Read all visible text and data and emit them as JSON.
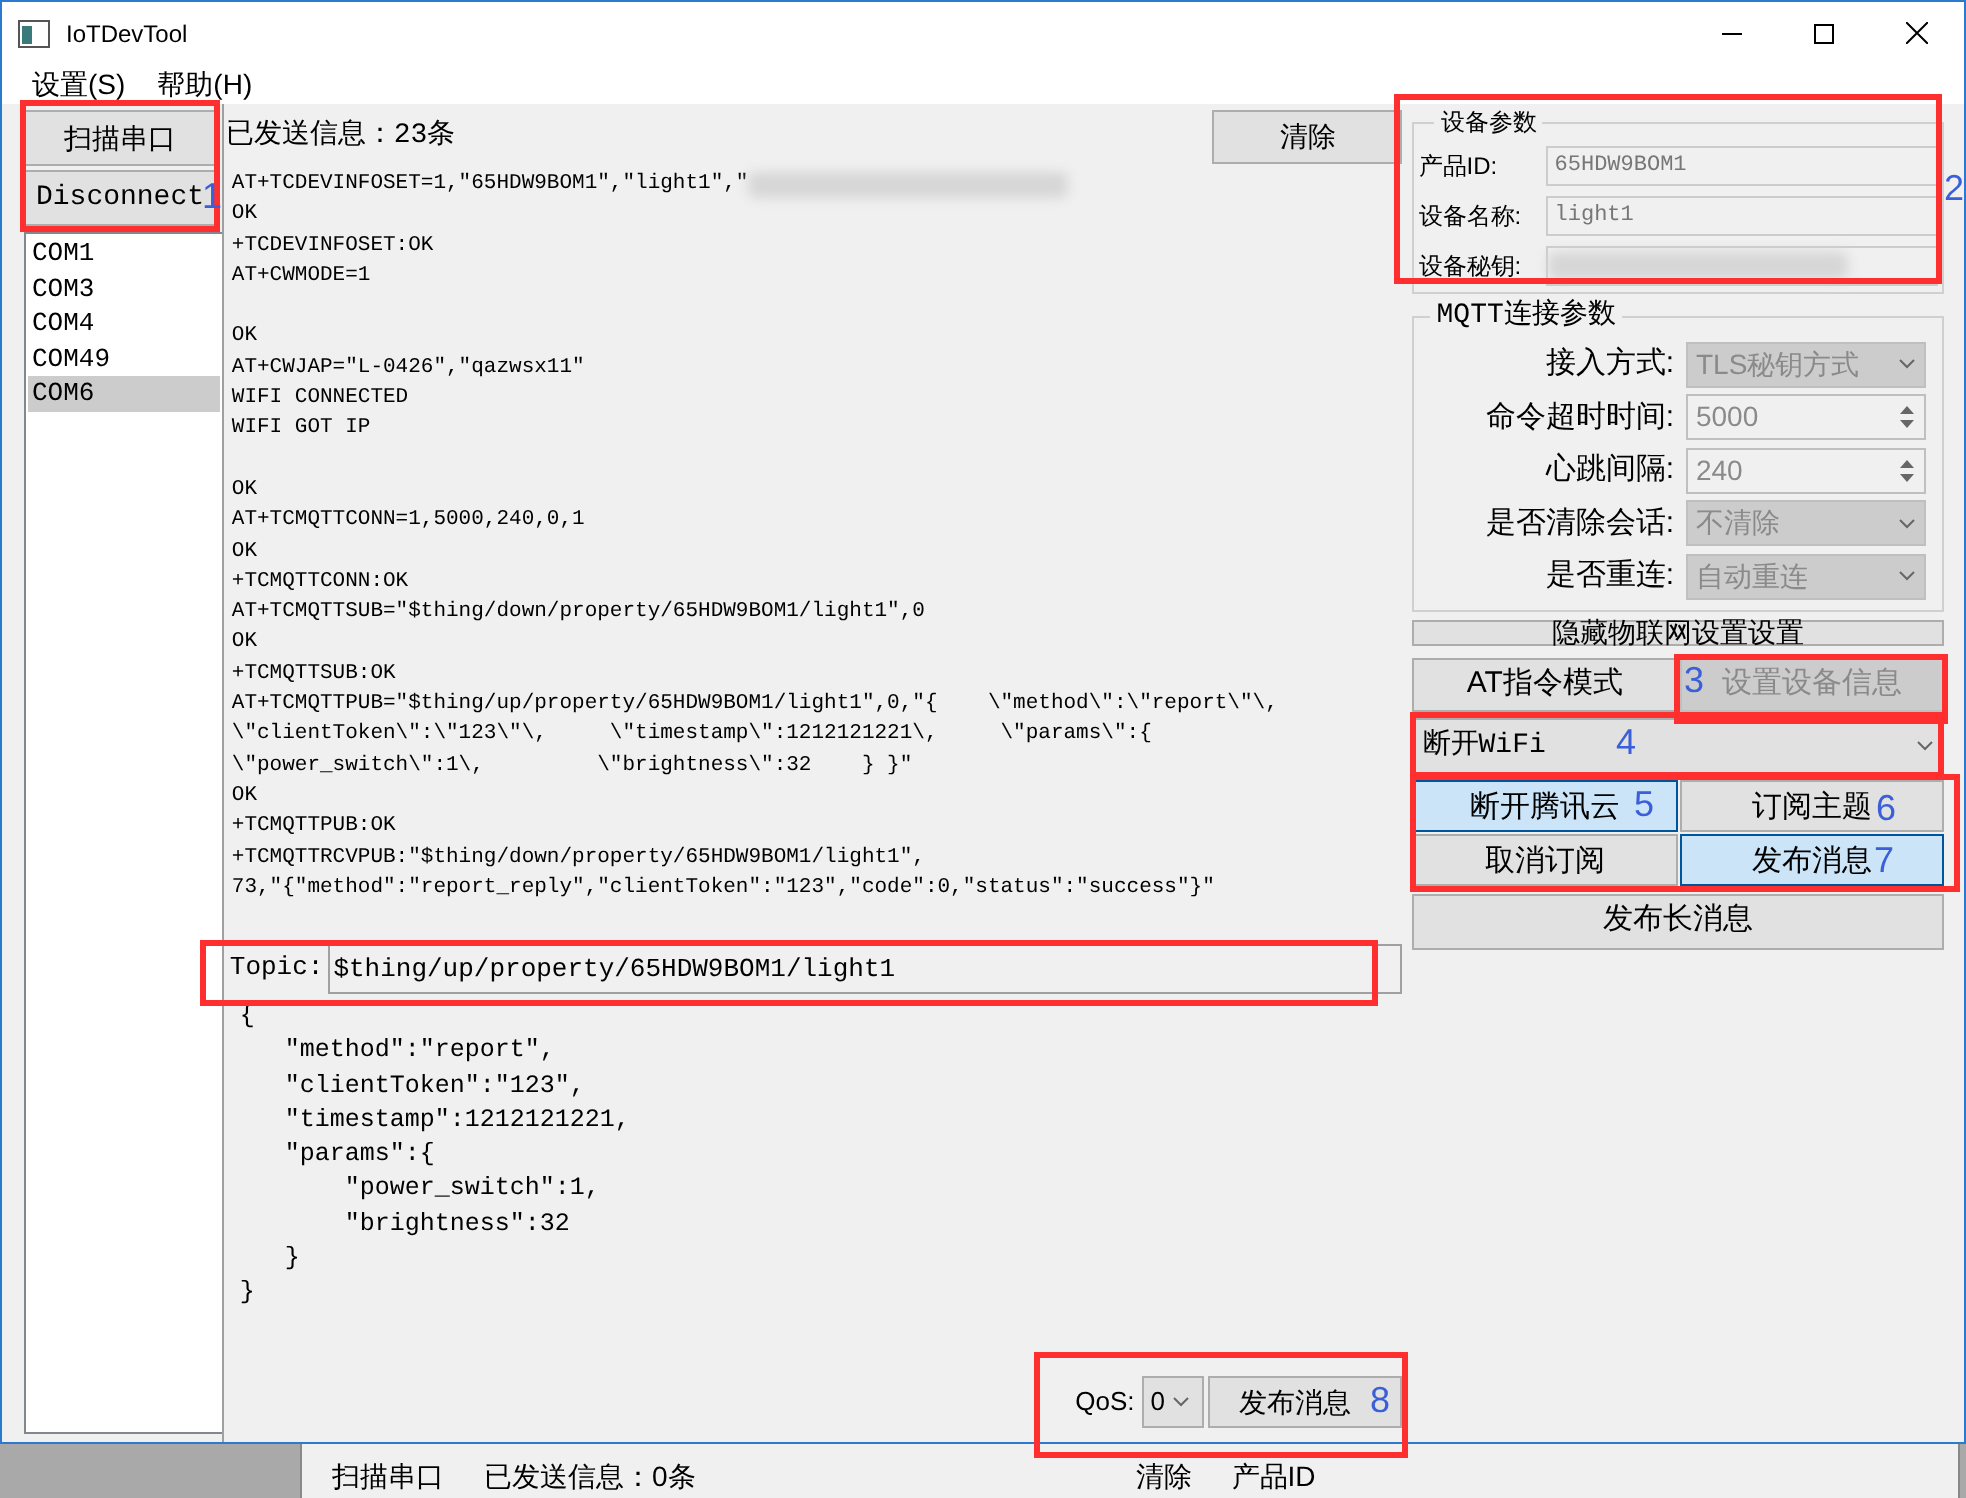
{
  "window": {
    "title": "IoTDevTool"
  },
  "menu": [
    "设置(S)",
    "帮助(H)"
  ],
  "left": {
    "buttons": [
      "扫描串口",
      "Disconnect"
    ],
    "ports": [
      {
        "label": "COM1",
        "selected": false
      },
      {
        "label": "COM3",
        "selected": false
      },
      {
        "label": "COM4",
        "selected": false
      },
      {
        "label": "COM49",
        "selected": false
      },
      {
        "label": "COM6",
        "selected": true
      }
    ]
  },
  "log": {
    "sent_count": "已发送信息：23条",
    "clear_button": "清除",
    "blocks": [
      [
        {
          "text": "AT+TCDEVINFOSET=1,\"65HDW9BOM1\",\"light1\",\"",
          "redacted": true
        },
        "OK",
        "+TCDEVINFOSET:OK",
        "AT+CWMODE=1"
      ],
      [
        "OK",
        "AT+CWJAP=\"L-0426\",\"qazwsx11\"",
        "WIFI CONNECTED",
        "WIFI GOT IP"
      ],
      [
        "OK",
        "AT+TCMQTTCONN=1,5000,240,0,1",
        "OK",
        "+TCMQTTCONN:OK",
        "AT+TCMQTTSUB=\"$thing/down/property/65HDW9BOM1/light1\",0",
        "OK",
        "+TCMQTTSUB:OK",
        "AT+TCMQTTPUB=\"$thing/up/property/65HDW9BOM1/light1\",0,\"{    \\\"method\\\":\\\"report\\\"\\,",
        "\\\"clientToken\\\":\\\"123\\\"\\,     \\\"timestamp\\\":1212121221\\,     \\\"params\\\":{",
        "\\\"power_switch\\\":1\\,         \\\"brightness\\\":32    } }\"",
        "OK",
        "+TCMQTTPUB:OK",
        "+TCMQTTRCVPUB:\"$thing/down/property/65HDW9BOM1/light1\",",
        "73,\"{\"method\":\"report_reply\",\"clientToken\":\"123\",\"code\":0,\"status\":\"success\"}\""
      ]
    ]
  },
  "topic": {
    "label": "Topic:",
    "value": "$thing/up/property/65HDW9BOM1/light1"
  },
  "payload": [
    "{",
    "   \"method\":\"report\",",
    "   \"clientToken\":\"123\",",
    "   \"timestamp\":1212121221,",
    "   \"params\":{",
    "       \"power_switch\":1,",
    "       \"brightness\":32",
    "   }",
    "}"
  ],
  "publish": {
    "qos_label": "QoS:",
    "qos_value": "0",
    "button": "发布消息"
  },
  "device_params": {
    "title": "设备参数",
    "fields": [
      {
        "label": "产品ID:",
        "value": "65HDW9BOM1",
        "blurred": false
      },
      {
        "label": "设备名称:",
        "value": "light1",
        "blurred": false
      },
      {
        "label": "设备秘钥:",
        "blurred": true
      }
    ]
  },
  "mqtt_params": {
    "title": "MQTT连接参数",
    "rows": [
      {
        "label": "接入方式:",
        "value": "TLS秘钥方式",
        "kind": "combo",
        "disabled": true
      },
      {
        "label": "命令超时时间:",
        "value": "5000",
        "kind": "spin",
        "disabled": true
      },
      {
        "label": "心跳间隔:",
        "value": "240",
        "kind": "spin",
        "disabled": true
      },
      {
        "label": "是否清除会话:",
        "value": "不清除",
        "kind": "combo",
        "disabled": true
      },
      {
        "label": "是否重连:",
        "value": "自动重连",
        "kind": "combo",
        "disabled": true
      }
    ]
  },
  "hide_settings_button": "隐藏物联网设置设置",
  "mode_buttons": [
    {
      "label": "AT指令模式",
      "disabled": false
    },
    {
      "label": "设置设备信息",
      "disabled": true
    }
  ],
  "command_combo": {
    "value": "断开WiFi"
  },
  "action_buttons": [
    {
      "label": "断开腾讯云",
      "highlighted": true
    },
    {
      "label": "订阅主题",
      "highlighted": false
    },
    {
      "label": "取消订阅",
      "highlighted": false
    },
    {
      "label": "发布消息",
      "highlighted": true
    }
  ],
  "long_message_button": "发布长消息",
  "callouts": [
    {
      "kind": "numbered",
      "numbers": [
        "1"
      ]
    },
    {
      "kind": "numbered",
      "numbers": [
        "2"
      ]
    },
    {
      "kind": "numbered",
      "numbers": [
        "3"
      ]
    },
    {
      "kind": "numbered",
      "numbers": [
        "4"
      ]
    },
    {
      "kind": "numbered",
      "numbers": [
        "5",
        "6",
        "7"
      ]
    },
    {
      "kind": "numbered",
      "numbers": [
        "8"
      ]
    },
    {
      "kind": "plain"
    }
  ],
  "background_window": {
    "texts": [
      "扫描串口",
      "已发送信息：0条",
      "清除",
      "产品ID"
    ]
  }
}
